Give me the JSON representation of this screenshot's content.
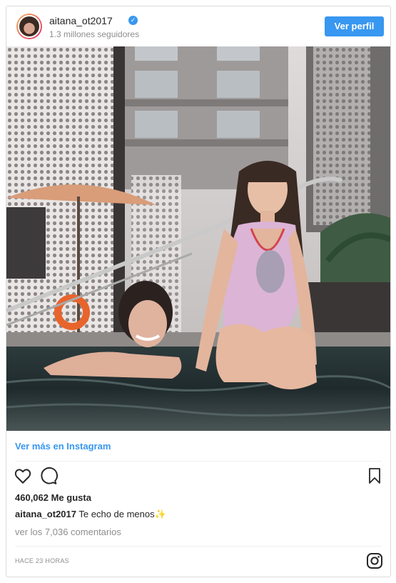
{
  "header": {
    "username": "aitana_ot2017",
    "followers": "1.3 millones seguidores",
    "view_profile_label": "Ver perfil"
  },
  "post": {
    "view_more_label": "Ver más en Instagram",
    "likes": "460,062 Me gusta",
    "caption_user": "aitana_ot2017",
    "caption_text": "Te echo de menos✨",
    "comments": "ver los 7,036 comentarios",
    "time": "HACE 23 HORAS"
  },
  "icons": {
    "like": "heart-icon",
    "comment": "comment-icon",
    "save": "bookmark-icon",
    "brand": "instagram-icon",
    "verified": "verified-badge-icon"
  },
  "colors": {
    "accent": "#3897f0",
    "text": "#262626",
    "muted": "#8e8e8e",
    "border": "#dbdbdb"
  }
}
